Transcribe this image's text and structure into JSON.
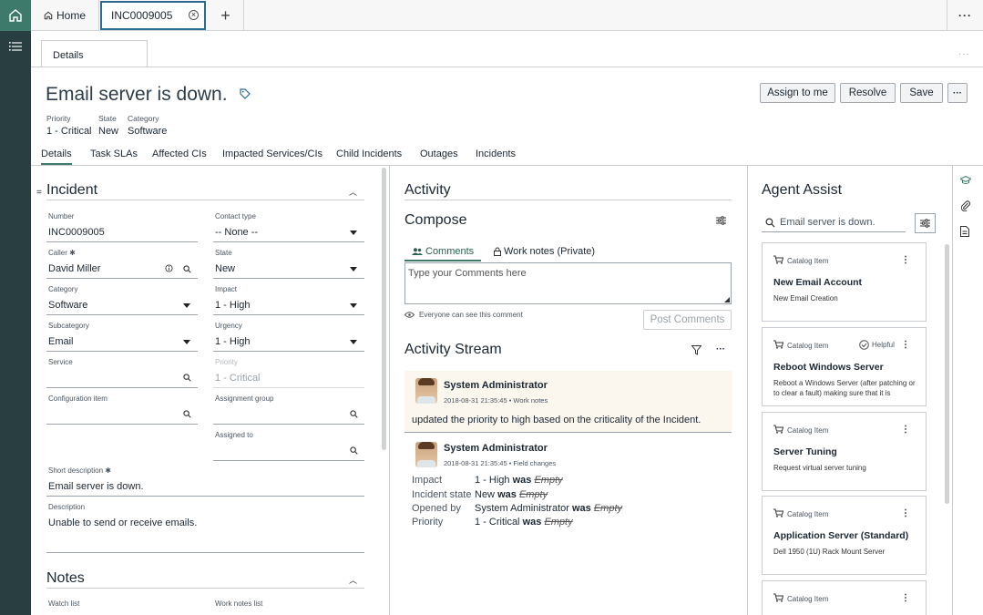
{
  "tabs": {
    "home_label": "Home",
    "active_tab": "INC0009005",
    "add_label": "+",
    "more_label": "···"
  },
  "subtab": {
    "label": "Details",
    "more_label": "···"
  },
  "record": {
    "title": "Email server is down.",
    "meta": [
      {
        "label": "Priority",
        "value": "1 - Critical"
      },
      {
        "label": "State",
        "value": "New"
      },
      {
        "label": "Category",
        "value": "Software"
      }
    ],
    "buttons": {
      "assign": "Assign to me",
      "resolve": "Resolve",
      "save": "Save",
      "more": "···"
    }
  },
  "form_tabs": [
    "Details",
    "Task SLAs",
    "Affected CIs",
    "Impacted Services/CIs",
    "Child Incidents",
    "Outages",
    "Incidents"
  ],
  "incident": {
    "section_title": "Incident",
    "number": {
      "label": "Number",
      "value": "INC0009005"
    },
    "contact_type": {
      "label": "Contact type",
      "value": "-- None --"
    },
    "caller": {
      "label": "Caller",
      "value": "David Miller"
    },
    "state": {
      "label": "State",
      "value": "New"
    },
    "category": {
      "label": "Category",
      "value": "Software"
    },
    "impact": {
      "label": "Impact",
      "value": "1 - High"
    },
    "subcategory": {
      "label": "Subcategory",
      "value": "Email"
    },
    "urgency": {
      "label": "Urgency",
      "value": "1 - High"
    },
    "service": {
      "label": "Service",
      "value": ""
    },
    "priority": {
      "label": "Priority",
      "value": "1 - Critical"
    },
    "config_item": {
      "label": "Configuration item",
      "value": ""
    },
    "assignment_group": {
      "label": "Assignment group",
      "value": ""
    },
    "assigned_to": {
      "label": "Assigned to",
      "value": ""
    },
    "short_description": {
      "label": "Short description",
      "value": "Email server is down."
    },
    "description": {
      "label": "Description",
      "value": "Unable to send or receive emails."
    }
  },
  "notes": {
    "section_title": "Notes",
    "watch_list_label": "Watch list",
    "work_notes_list_label": "Work notes list"
  },
  "activity": {
    "title": "Activity",
    "compose_title": "Compose",
    "tab_comments": "Comments",
    "tab_work_notes": "Work notes (Private)",
    "comment_placeholder": "Type your Comments here",
    "visibility_note": "Everyone can see this comment",
    "post_button": "Post Comments",
    "stream_title": "Activity Stream",
    "entries": [
      {
        "author": "System Administrator",
        "meta": "2018-08-31 21:35:45 • Work notes",
        "text": "updated the priority to high based on the criticality of the Incident."
      },
      {
        "author": "System Administrator",
        "meta": "2018-08-31 21:35:45 • Field changes",
        "changes": [
          {
            "field": "Impact",
            "value": "1 - High",
            "was": "was",
            "old": "Empty"
          },
          {
            "field": "Incident state",
            "value": "New",
            "was": "was",
            "old": "Empty"
          },
          {
            "field": "Opened by",
            "value": "System Administrator",
            "was": "was",
            "old": "Empty"
          },
          {
            "field": "Priority",
            "value": "1 - Critical",
            "was": "was",
            "old": "Empty"
          }
        ]
      }
    ]
  },
  "agent_assist": {
    "title": "Agent Assist",
    "search_value": "Email server is down.",
    "cards": [
      {
        "type": "Catalog Item",
        "title": "New Email Account",
        "desc": "New Email Creation",
        "badge": ""
      },
      {
        "type": "Catalog Item",
        "title": "Reboot Windows Server",
        "desc": "Reboot a Windows Server (after patching or to clear a fault) making sure that it is",
        "badge": "Helpful"
      },
      {
        "type": "Catalog Item",
        "title": "Server Tuning",
        "desc": "Request virtual server tuning",
        "badge": ""
      },
      {
        "type": "Catalog Item",
        "title": "Application Server (Standard)",
        "desc": "Dell 1950 (1U) Rack Mount Server",
        "badge": ""
      },
      {
        "type": "Catalog Item",
        "title": "",
        "desc": "",
        "badge": ""
      }
    ]
  },
  "colors": {
    "rail": "#293e40",
    "accent": "#3d7a6b",
    "active_tab_border": "#2c6a8f",
    "stream_highlight": "#fbf6ee"
  }
}
